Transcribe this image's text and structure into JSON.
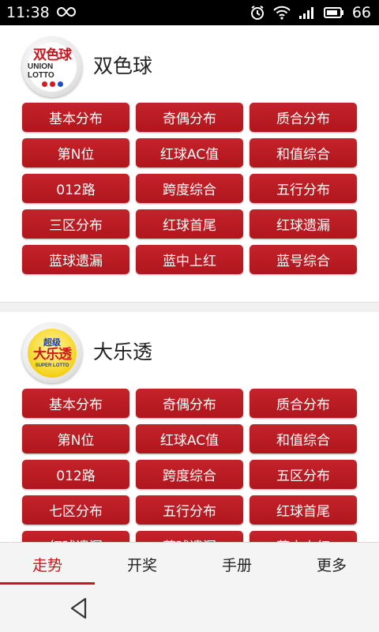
{
  "status_bar": {
    "time": "11:38",
    "battery_level": "66"
  },
  "sections": [
    {
      "title": "双色球",
      "logo_text": "双色球",
      "logo_sub": "UNION LOTTO",
      "buttons": [
        "基本分布",
        "奇偶分布",
        "质合分布",
        "第N位",
        "红球AC值",
        "和值综合",
        "012路",
        "跨度综合",
        "五行分布",
        "三区分布",
        "红球首尾",
        "红球遗漏",
        "蓝球遗漏",
        "蓝中上红",
        "蓝号综合"
      ]
    },
    {
      "title": "大乐透",
      "logo_top": "超级",
      "logo_text": "大乐透",
      "logo_sub": "SUPER LOTTO",
      "buttons": [
        "基本分布",
        "奇偶分布",
        "质合分布",
        "第N位",
        "红球AC值",
        "和值综合",
        "012路",
        "跨度综合",
        "五区分布",
        "七区分布",
        "五行分布",
        "红球首尾",
        "红球遗漏",
        "蓝球遗漏",
        "蓝中上红"
      ]
    }
  ],
  "tabs": [
    "走势",
    "开奖",
    "手册",
    "更多"
  ],
  "active_tab": "走势",
  "colors": {
    "accent": "#c8161d",
    "button": "#b81c22"
  }
}
